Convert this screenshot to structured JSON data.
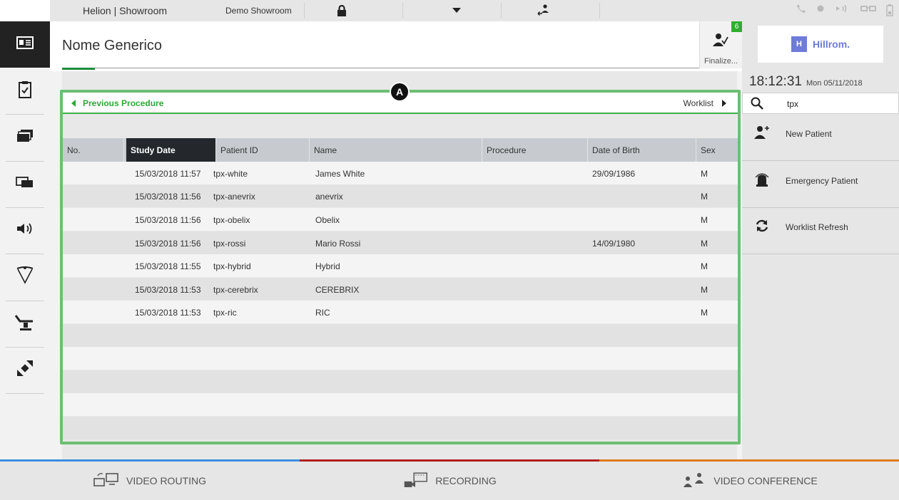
{
  "topbar": {
    "brand": "Helion | Showroom",
    "room": "Demo Showroom",
    "icons": [
      "lock-icon",
      "dropdown-icon",
      "transfer-icon",
      "phone-icon",
      "record-dot-icon",
      "broadcast-icon",
      "glasses-icon",
      "battery-icon"
    ]
  },
  "header": {
    "title": "Nome Generico",
    "finalize_label": "Finalize...",
    "finalize_badge": "6"
  },
  "annotation": "A",
  "procedure_nav": {
    "prev_label": "Previous Procedure",
    "next_label": "Worklist"
  },
  "table": {
    "columns": [
      "No.",
      "Study Date",
      "Patient ID",
      "Name",
      "Procedure",
      "Date of Birth",
      "Sex"
    ],
    "sorted_column": "Study Date",
    "rows": [
      {
        "no": "",
        "study_date": "15/03/2018 11:57",
        "patient_id": "tpx-white",
        "name": "James White",
        "procedure": "",
        "dob": "29/09/1986",
        "sex": "M"
      },
      {
        "no": "",
        "study_date": "15/03/2018 11:56",
        "patient_id": "tpx-anevrix",
        "name": "anevrix",
        "procedure": "",
        "dob": "",
        "sex": "M"
      },
      {
        "no": "",
        "study_date": "15/03/2018 11:56",
        "patient_id": "tpx-obelix",
        "name": "Obelix",
        "procedure": "",
        "dob": "",
        "sex": "M"
      },
      {
        "no": "",
        "study_date": "15/03/2018 11:56",
        "patient_id": "tpx-rossi",
        "name": "Mario Rossi",
        "procedure": "",
        "dob": "14/09/1980",
        "sex": "M"
      },
      {
        "no": "",
        "study_date": "15/03/2018 11:55",
        "patient_id": "tpx-hybrid",
        "name": "Hybrid",
        "procedure": "",
        "dob": "",
        "sex": "M"
      },
      {
        "no": "",
        "study_date": "15/03/2018 11:53",
        "patient_id": "tpx-cerebrix",
        "name": "CEREBRIX",
        "procedure": "",
        "dob": "",
        "sex": "M"
      },
      {
        "no": "",
        "study_date": "15/03/2018 11:53",
        "patient_id": "tpx-ric",
        "name": "RIC",
        "procedure": "",
        "dob": "",
        "sex": "M"
      }
    ]
  },
  "right_panel": {
    "logo_mark": "H",
    "logo_text": "Hillrom.",
    "time": "18:12:31",
    "date": "Mon 05/11/2018",
    "search_value": "tpx",
    "actions": {
      "new_patient": "New Patient",
      "emergency_patient": "Emergency Patient",
      "worklist_refresh": "Worklist Refresh"
    }
  },
  "bottom": {
    "video_routing": "VIDEO ROUTING",
    "recording": "RECORDING",
    "video_conference": "VIDEO CONFERENCE"
  },
  "colors": {
    "accent_green": "#2ea836",
    "frame_green": "#6cbf72",
    "routing_blue": "#3b8fe0",
    "recording_red": "#b31e1e",
    "conference_orange": "#e07a1a",
    "logo_purple": "#6e7bd9"
  }
}
